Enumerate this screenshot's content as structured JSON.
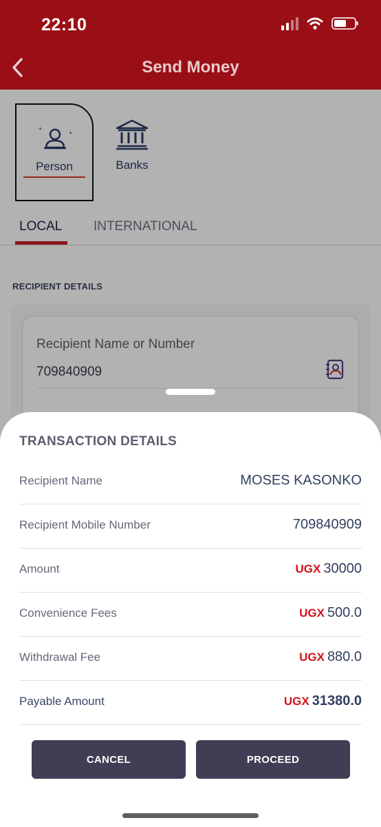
{
  "status_bar": {
    "time": "22:10"
  },
  "header": {
    "title": "Send Money",
    "back_icon": "chevron-left-icon"
  },
  "categories": [
    {
      "label": "Person",
      "icon": "person-icon",
      "selected": true
    },
    {
      "label": "Banks",
      "icon": "bank-icon",
      "selected": false
    }
  ],
  "tabs": [
    {
      "label": "LOCAL",
      "active": true
    },
    {
      "label": "INTERNATIONAL",
      "active": false
    }
  ],
  "recipient": {
    "section_label": "RECIPIENT DETAILS",
    "field_label": "Recipient Name or Number",
    "field_value": "709840909",
    "contact_icon": "contact-book-icon"
  },
  "sheet": {
    "title": "TRANSACTION DETAILS",
    "rows": [
      {
        "key": "Recipient Name",
        "value": "MOSES KASONKO"
      },
      {
        "key": "Recipient Mobile Number",
        "value": "709840909"
      },
      {
        "key": "Amount",
        "currency": "UGX",
        "value": "30000"
      },
      {
        "key": "Convenience Fees",
        "currency": "UGX",
        "value": "500.0"
      },
      {
        "key": "Withdrawal Fee",
        "currency": "UGX",
        "value": "880.0"
      },
      {
        "key": "Payable Amount",
        "currency": "UGX",
        "value": "31380.0"
      }
    ],
    "cancel_label": "CANCEL",
    "proceed_label": "PROCEED"
  },
  "colors": {
    "brand_red": "#9a0f16",
    "accent_red": "#d4111a",
    "button": "#403e55"
  }
}
